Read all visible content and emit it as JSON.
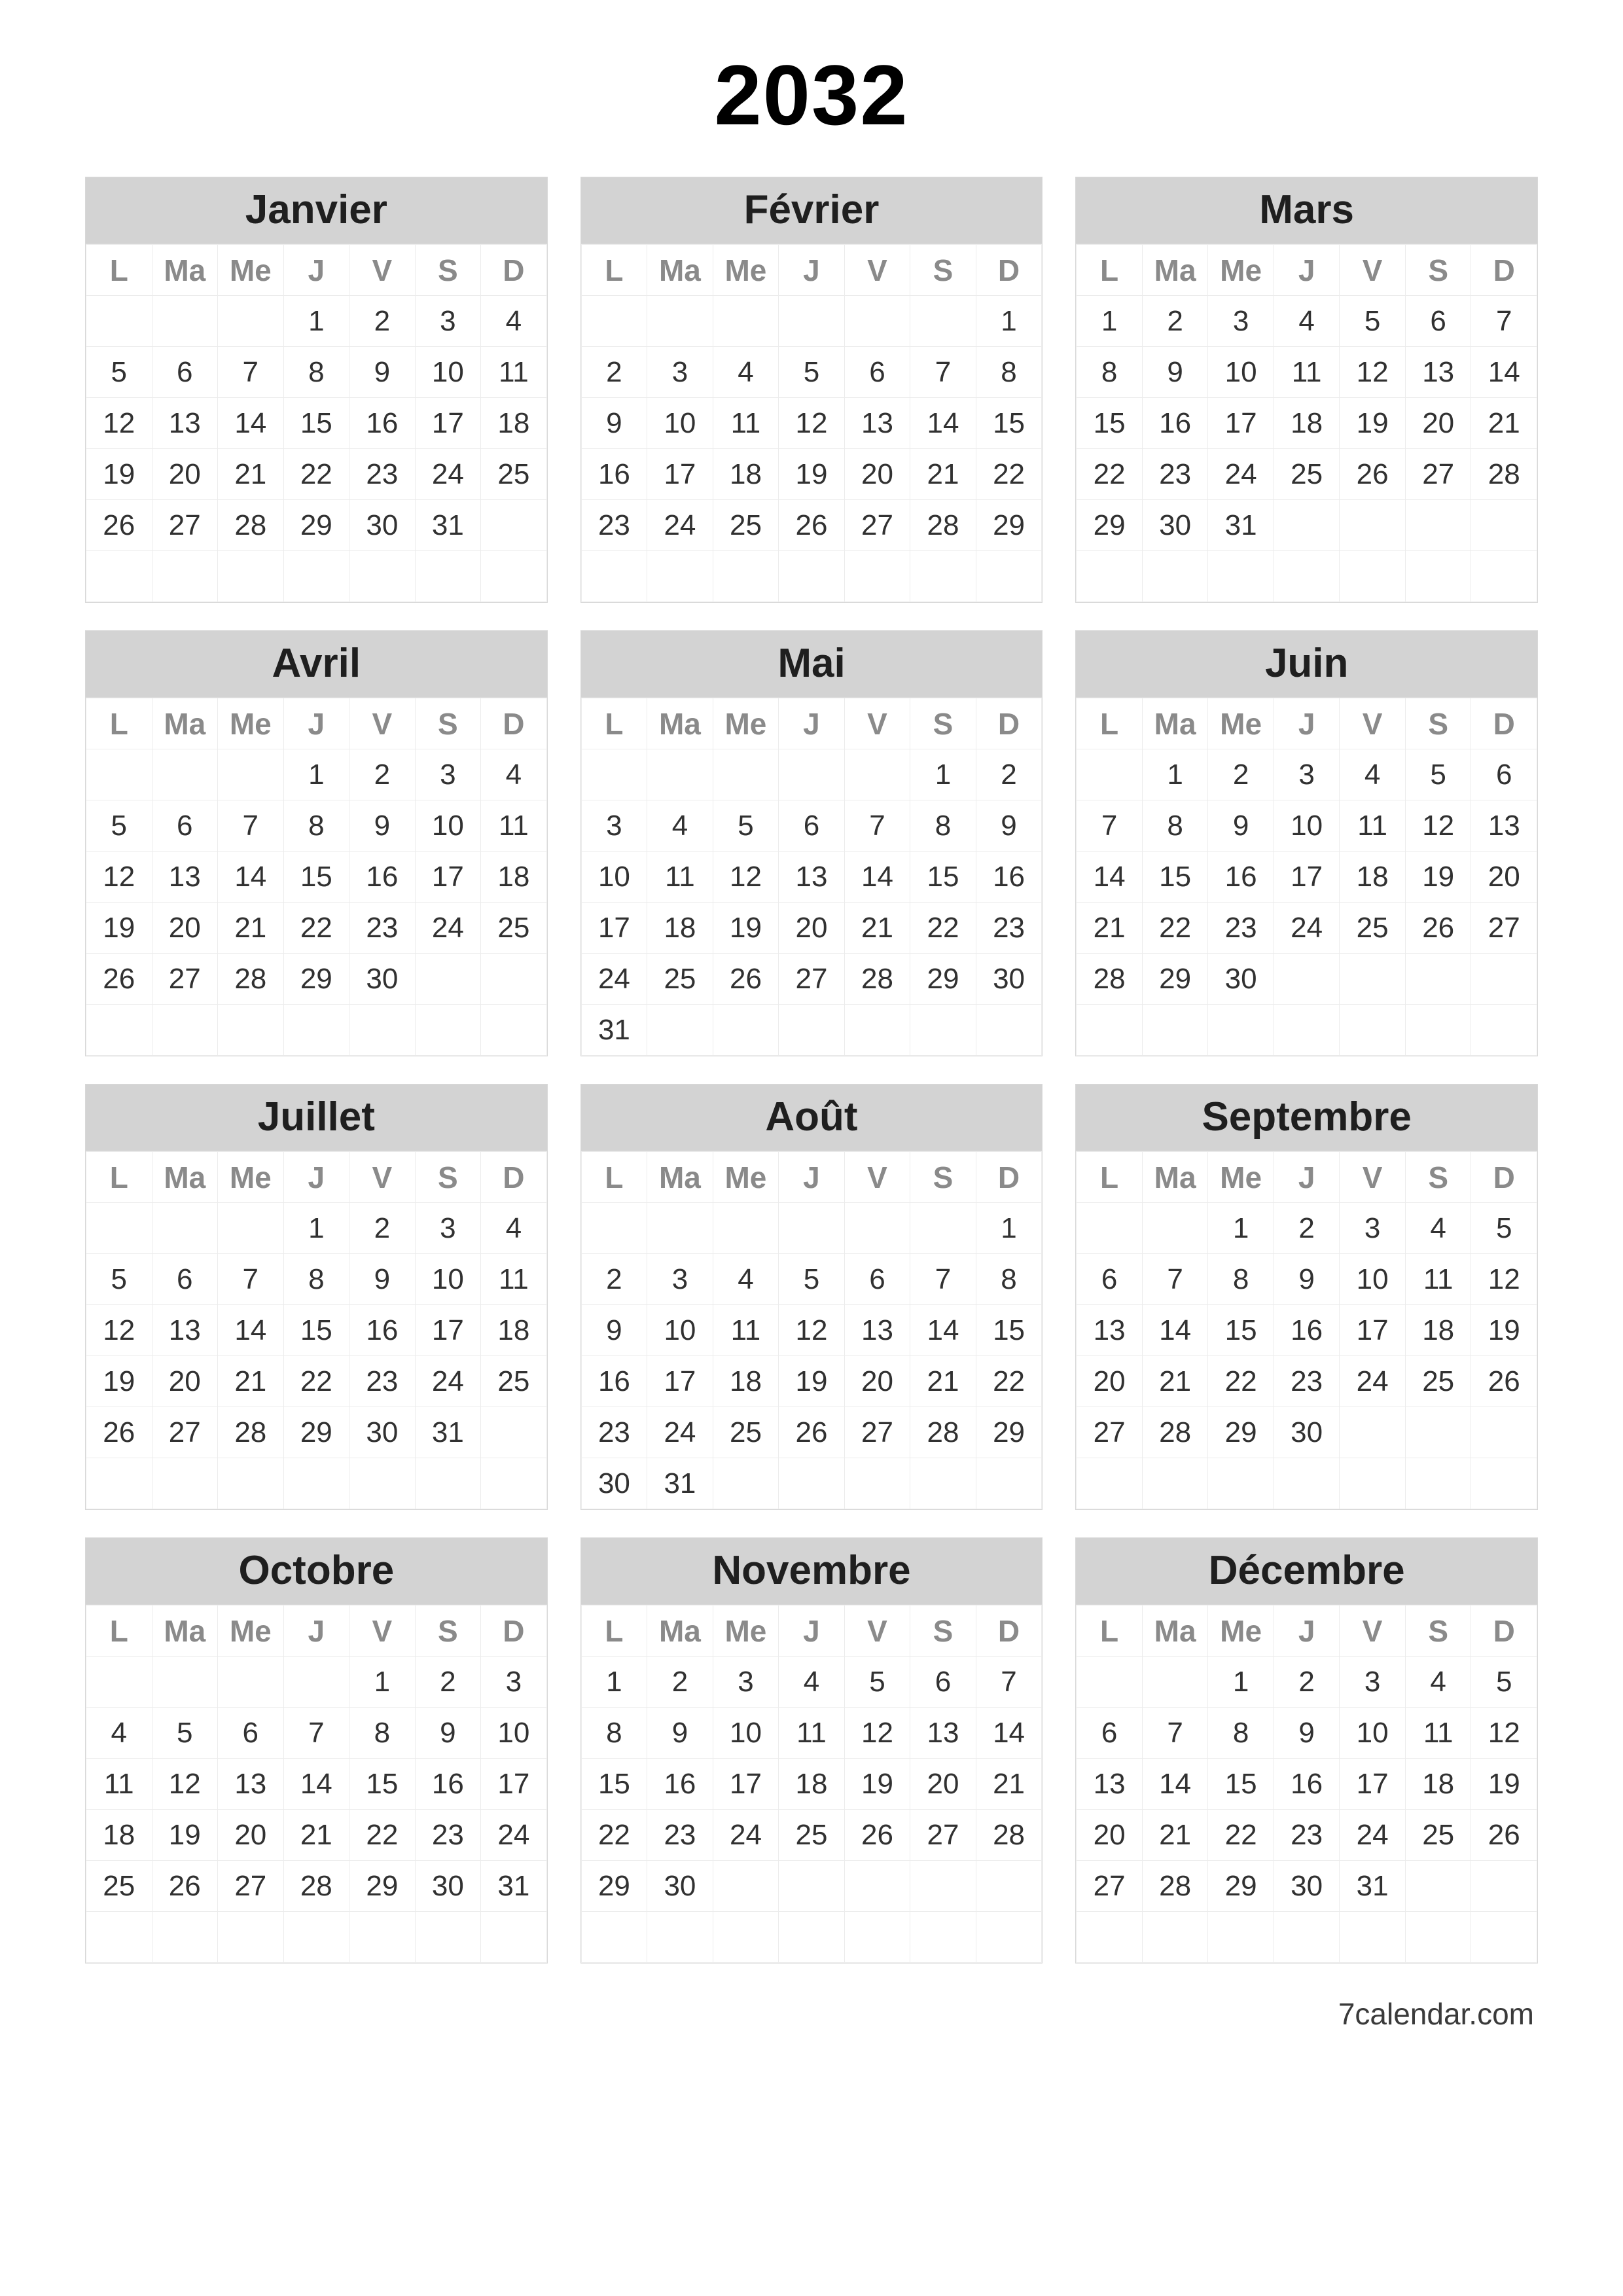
{
  "year": "2032",
  "footer": "7calendar.com",
  "weekdays": [
    "L",
    "Ma",
    "Me",
    "J",
    "V",
    "S",
    "D"
  ],
  "months": [
    {
      "name": "Janvier",
      "weeks": [
        [
          "",
          "",
          "",
          "1",
          "2",
          "3",
          "4"
        ],
        [
          "5",
          "6",
          "7",
          "8",
          "9",
          "10",
          "11"
        ],
        [
          "12",
          "13",
          "14",
          "15",
          "16",
          "17",
          "18"
        ],
        [
          "19",
          "20",
          "21",
          "22",
          "23",
          "24",
          "25"
        ],
        [
          "26",
          "27",
          "28",
          "29",
          "30",
          "31",
          ""
        ],
        [
          "",
          "",
          "",
          "",
          "",
          "",
          ""
        ]
      ]
    },
    {
      "name": "Février",
      "weeks": [
        [
          "",
          "",
          "",
          "",
          "",
          "",
          "1"
        ],
        [
          "2",
          "3",
          "4",
          "5",
          "6",
          "7",
          "8"
        ],
        [
          "9",
          "10",
          "11",
          "12",
          "13",
          "14",
          "15"
        ],
        [
          "16",
          "17",
          "18",
          "19",
          "20",
          "21",
          "22"
        ],
        [
          "23",
          "24",
          "25",
          "26",
          "27",
          "28",
          "29"
        ],
        [
          "",
          "",
          "",
          "",
          "",
          "",
          ""
        ]
      ]
    },
    {
      "name": "Mars",
      "weeks": [
        [
          "1",
          "2",
          "3",
          "4",
          "5",
          "6",
          "7"
        ],
        [
          "8",
          "9",
          "10",
          "11",
          "12",
          "13",
          "14"
        ],
        [
          "15",
          "16",
          "17",
          "18",
          "19",
          "20",
          "21"
        ],
        [
          "22",
          "23",
          "24",
          "25",
          "26",
          "27",
          "28"
        ],
        [
          "29",
          "30",
          "31",
          "",
          "",
          "",
          ""
        ],
        [
          "",
          "",
          "",
          "",
          "",
          "",
          ""
        ]
      ]
    },
    {
      "name": "Avril",
      "weeks": [
        [
          "",
          "",
          "",
          "1",
          "2",
          "3",
          "4"
        ],
        [
          "5",
          "6",
          "7",
          "8",
          "9",
          "10",
          "11"
        ],
        [
          "12",
          "13",
          "14",
          "15",
          "16",
          "17",
          "18"
        ],
        [
          "19",
          "20",
          "21",
          "22",
          "23",
          "24",
          "25"
        ],
        [
          "26",
          "27",
          "28",
          "29",
          "30",
          "",
          ""
        ],
        [
          "",
          "",
          "",
          "",
          "",
          "",
          ""
        ]
      ]
    },
    {
      "name": "Mai",
      "weeks": [
        [
          "",
          "",
          "",
          "",
          "",
          "1",
          "2"
        ],
        [
          "3",
          "4",
          "5",
          "6",
          "7",
          "8",
          "9"
        ],
        [
          "10",
          "11",
          "12",
          "13",
          "14",
          "15",
          "16"
        ],
        [
          "17",
          "18",
          "19",
          "20",
          "21",
          "22",
          "23"
        ],
        [
          "24",
          "25",
          "26",
          "27",
          "28",
          "29",
          "30"
        ],
        [
          "31",
          "",
          "",
          "",
          "",
          "",
          ""
        ]
      ]
    },
    {
      "name": "Juin",
      "weeks": [
        [
          "",
          "1",
          "2",
          "3",
          "4",
          "5",
          "6"
        ],
        [
          "7",
          "8",
          "9",
          "10",
          "11",
          "12",
          "13"
        ],
        [
          "14",
          "15",
          "16",
          "17",
          "18",
          "19",
          "20"
        ],
        [
          "21",
          "22",
          "23",
          "24",
          "25",
          "26",
          "27"
        ],
        [
          "28",
          "29",
          "30",
          "",
          "",
          "",
          ""
        ],
        [
          "",
          "",
          "",
          "",
          "",
          "",
          ""
        ]
      ]
    },
    {
      "name": "Juillet",
      "weeks": [
        [
          "",
          "",
          "",
          "1",
          "2",
          "3",
          "4"
        ],
        [
          "5",
          "6",
          "7",
          "8",
          "9",
          "10",
          "11"
        ],
        [
          "12",
          "13",
          "14",
          "15",
          "16",
          "17",
          "18"
        ],
        [
          "19",
          "20",
          "21",
          "22",
          "23",
          "24",
          "25"
        ],
        [
          "26",
          "27",
          "28",
          "29",
          "30",
          "31",
          ""
        ],
        [
          "",
          "",
          "",
          "",
          "",
          "",
          ""
        ]
      ]
    },
    {
      "name": "Août",
      "weeks": [
        [
          "",
          "",
          "",
          "",
          "",
          "",
          "1"
        ],
        [
          "2",
          "3",
          "4",
          "5",
          "6",
          "7",
          "8"
        ],
        [
          "9",
          "10",
          "11",
          "12",
          "13",
          "14",
          "15"
        ],
        [
          "16",
          "17",
          "18",
          "19",
          "20",
          "21",
          "22"
        ],
        [
          "23",
          "24",
          "25",
          "26",
          "27",
          "28",
          "29"
        ],
        [
          "30",
          "31",
          "",
          "",
          "",
          "",
          ""
        ]
      ]
    },
    {
      "name": "Septembre",
      "weeks": [
        [
          "",
          "",
          "1",
          "2",
          "3",
          "4",
          "5"
        ],
        [
          "6",
          "7",
          "8",
          "9",
          "10",
          "11",
          "12"
        ],
        [
          "13",
          "14",
          "15",
          "16",
          "17",
          "18",
          "19"
        ],
        [
          "20",
          "21",
          "22",
          "23",
          "24",
          "25",
          "26"
        ],
        [
          "27",
          "28",
          "29",
          "30",
          "",
          "",
          ""
        ],
        [
          "",
          "",
          "",
          "",
          "",
          "",
          ""
        ]
      ]
    },
    {
      "name": "Octobre",
      "weeks": [
        [
          "",
          "",
          "",
          "",
          "1",
          "2",
          "3"
        ],
        [
          "4",
          "5",
          "6",
          "7",
          "8",
          "9",
          "10"
        ],
        [
          "11",
          "12",
          "13",
          "14",
          "15",
          "16",
          "17"
        ],
        [
          "18",
          "19",
          "20",
          "21",
          "22",
          "23",
          "24"
        ],
        [
          "25",
          "26",
          "27",
          "28",
          "29",
          "30",
          "31"
        ],
        [
          "",
          "",
          "",
          "",
          "",
          "",
          ""
        ]
      ]
    },
    {
      "name": "Novembre",
      "weeks": [
        [
          "1",
          "2",
          "3",
          "4",
          "5",
          "6",
          "7"
        ],
        [
          "8",
          "9",
          "10",
          "11",
          "12",
          "13",
          "14"
        ],
        [
          "15",
          "16",
          "17",
          "18",
          "19",
          "20",
          "21"
        ],
        [
          "22",
          "23",
          "24",
          "25",
          "26",
          "27",
          "28"
        ],
        [
          "29",
          "30",
          "",
          "",
          "",
          "",
          ""
        ],
        [
          "",
          "",
          "",
          "",
          "",
          "",
          ""
        ]
      ]
    },
    {
      "name": "Décembre",
      "weeks": [
        [
          "",
          "",
          "1",
          "2",
          "3",
          "4",
          "5"
        ],
        [
          "6",
          "7",
          "8",
          "9",
          "10",
          "11",
          "12"
        ],
        [
          "13",
          "14",
          "15",
          "16",
          "17",
          "18",
          "19"
        ],
        [
          "20",
          "21",
          "22",
          "23",
          "24",
          "25",
          "26"
        ],
        [
          "27",
          "28",
          "29",
          "30",
          "31",
          "",
          ""
        ],
        [
          "",
          "",
          "",
          "",
          "",
          "",
          ""
        ]
      ]
    }
  ]
}
